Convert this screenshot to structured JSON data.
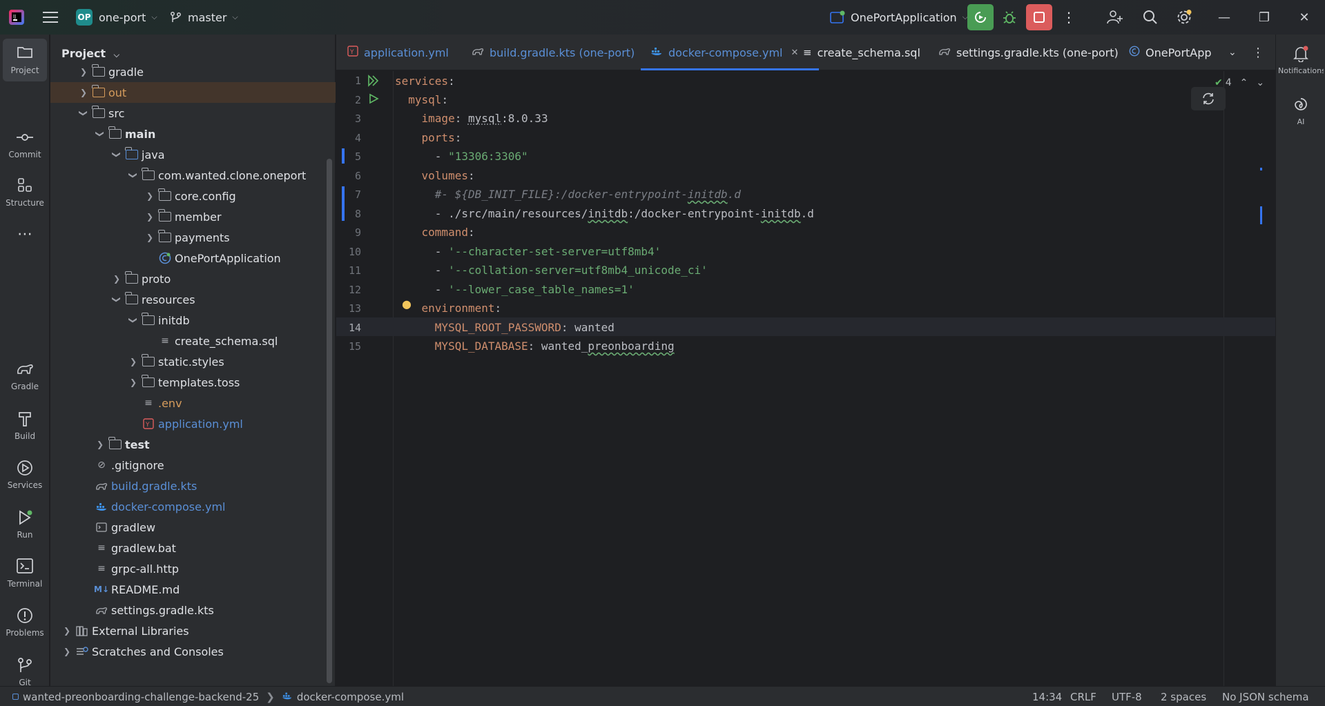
{
  "titlebar": {
    "project_badge": "OP",
    "project_name": "one-port",
    "branch": "master",
    "run_config": "OnePortApplication"
  },
  "left_tools": [
    {
      "label": "Project"
    },
    {
      "label": "Commit"
    },
    {
      "label": "Structure"
    },
    {
      "label": "Gradle"
    },
    {
      "label": "Build"
    },
    {
      "label": "Services"
    },
    {
      "label": "Run"
    },
    {
      "label": "Terminal"
    },
    {
      "label": "Problems"
    },
    {
      "label": "Git"
    }
  ],
  "project_panel": {
    "title": "Project",
    "tree": [
      {
        "label": "gradle"
      },
      {
        "label": "out"
      },
      {
        "label": "src"
      },
      {
        "label": "main"
      },
      {
        "label": "java"
      },
      {
        "label": "com.wanted.clone.oneport"
      },
      {
        "label": "core.config"
      },
      {
        "label": "member"
      },
      {
        "label": "payments"
      },
      {
        "label": "OnePortApplication"
      },
      {
        "label": "proto"
      },
      {
        "label": "resources"
      },
      {
        "label": "initdb"
      },
      {
        "label": "create_schema.sql"
      },
      {
        "label": "static.styles"
      },
      {
        "label": "templates.toss"
      },
      {
        "label": ".env"
      },
      {
        "label": "application.yml"
      },
      {
        "label": "test"
      },
      {
        "label": ".gitignore"
      },
      {
        "label": "build.gradle.kts"
      },
      {
        "label": "docker-compose.yml"
      },
      {
        "label": "gradlew"
      },
      {
        "label": "gradlew.bat"
      },
      {
        "label": "grpc-all.http"
      },
      {
        "label": "README.md"
      },
      {
        "label": "settings.gradle.kts"
      },
      {
        "label": "External Libraries"
      },
      {
        "label": "Scratches and Consoles"
      }
    ]
  },
  "tabs": [
    {
      "label": "application.yml"
    },
    {
      "label": "build.gradle.kts (one-port)"
    },
    {
      "label": "docker-compose.yml"
    },
    {
      "label": "create_schema.sql"
    },
    {
      "label": "settings.gradle.kts (one-port)"
    },
    {
      "label": "OnePortApplica"
    }
  ],
  "editor": {
    "inspection_count": "4",
    "line_numbers": [
      "1",
      "2",
      "3",
      "4",
      "5",
      "6",
      "7",
      "8",
      "9",
      "10",
      "11",
      "12",
      "13",
      "14",
      "15"
    ],
    "code": {
      "l1_key": "services",
      "l2_key": "mysql",
      "l3_key": "image",
      "l3_a": "mysql",
      "l3_b": ":8.0.33",
      "l4_key": "ports",
      "l5_val": "\"13306:3306\"",
      "l6_key": "volumes",
      "l7_a": "#- ${DB_INIT_FILE}:/docker-entrypoint-",
      "l7_b": "initdb",
      "l7_c": ".d",
      "l8_a": "- ./src/main/resources/",
      "l8_b": "initdb",
      "l8_c": ":/docker-entrypoint-",
      "l8_d": "initdb",
      "l8_e": ".d",
      "l9_key": "command",
      "l10_val": "'--character-set-server=utf8mb4'",
      "l11_val": "'--collation-server=utf8mb4_unicode_ci'",
      "l12_val": "'--lower_case_table_names=1'",
      "l13_key": "environment",
      "l14_key": "MYSQL_ROOT_PASSWORD",
      "l14_val": "wanted",
      "l15_key": "MYSQL_DATABASE",
      "l15_val_a": "wanted_",
      "l15_val_b": "preonboarding"
    }
  },
  "right_tools": [
    {
      "label": "Notifications"
    },
    {
      "label": "AI"
    }
  ],
  "statusbar": {
    "project": "wanted-preonboarding-challenge-backend-25",
    "file": "docker-compose.yml",
    "position": "14:34",
    "line_sep": "CRLF",
    "encoding": "UTF-8",
    "indent": "2 spaces",
    "schema": "No JSON schema"
  },
  "colors": {
    "accent": "#3574f0",
    "run_green": "#499c54",
    "stop_red": "#db5c5c",
    "yaml_key": "#cf8e6d",
    "yaml_string": "#6aab73"
  }
}
